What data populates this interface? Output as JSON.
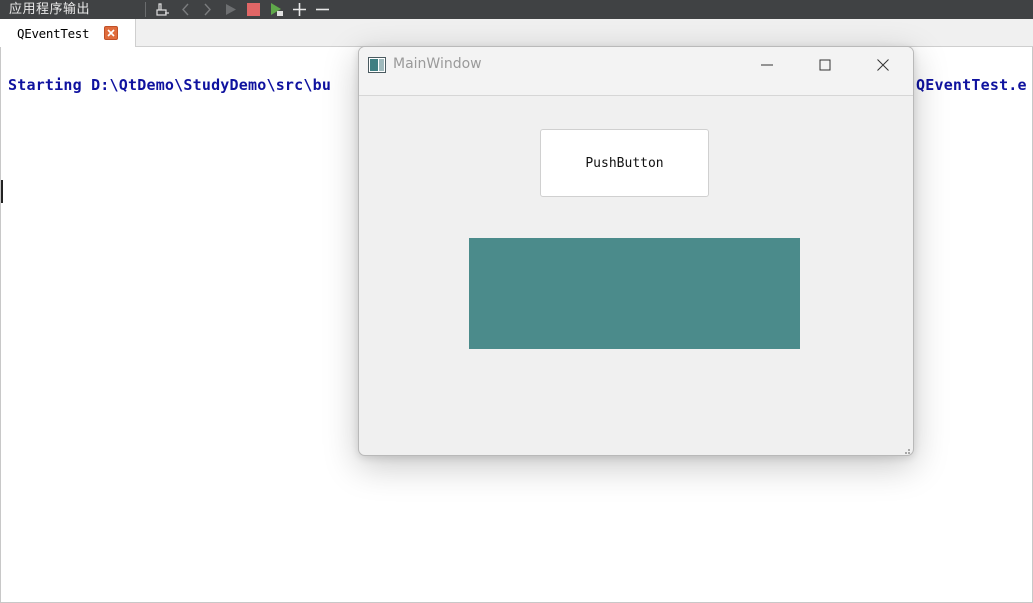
{
  "panel": {
    "title": "应用程序输出",
    "toolbar_icons": [
      "attach-debugger-icon",
      "previous-icon",
      "next-icon",
      "run-icon",
      "stop-icon",
      "rerun-debug-icon",
      "zoom-in-icon",
      "zoom-out-icon"
    ]
  },
  "tabs": [
    {
      "label": "QEventTest",
      "active": true
    }
  ],
  "output": {
    "line_start": "Starting D:\\QtDemo\\StudyDemo\\src\\bu",
    "line_end": "QEventTest.e",
    "text_color": "#0f129f"
  },
  "main_window": {
    "title": "MainWindow",
    "push_button_label": "PushButton",
    "rect_color": "#4b8b8b"
  }
}
